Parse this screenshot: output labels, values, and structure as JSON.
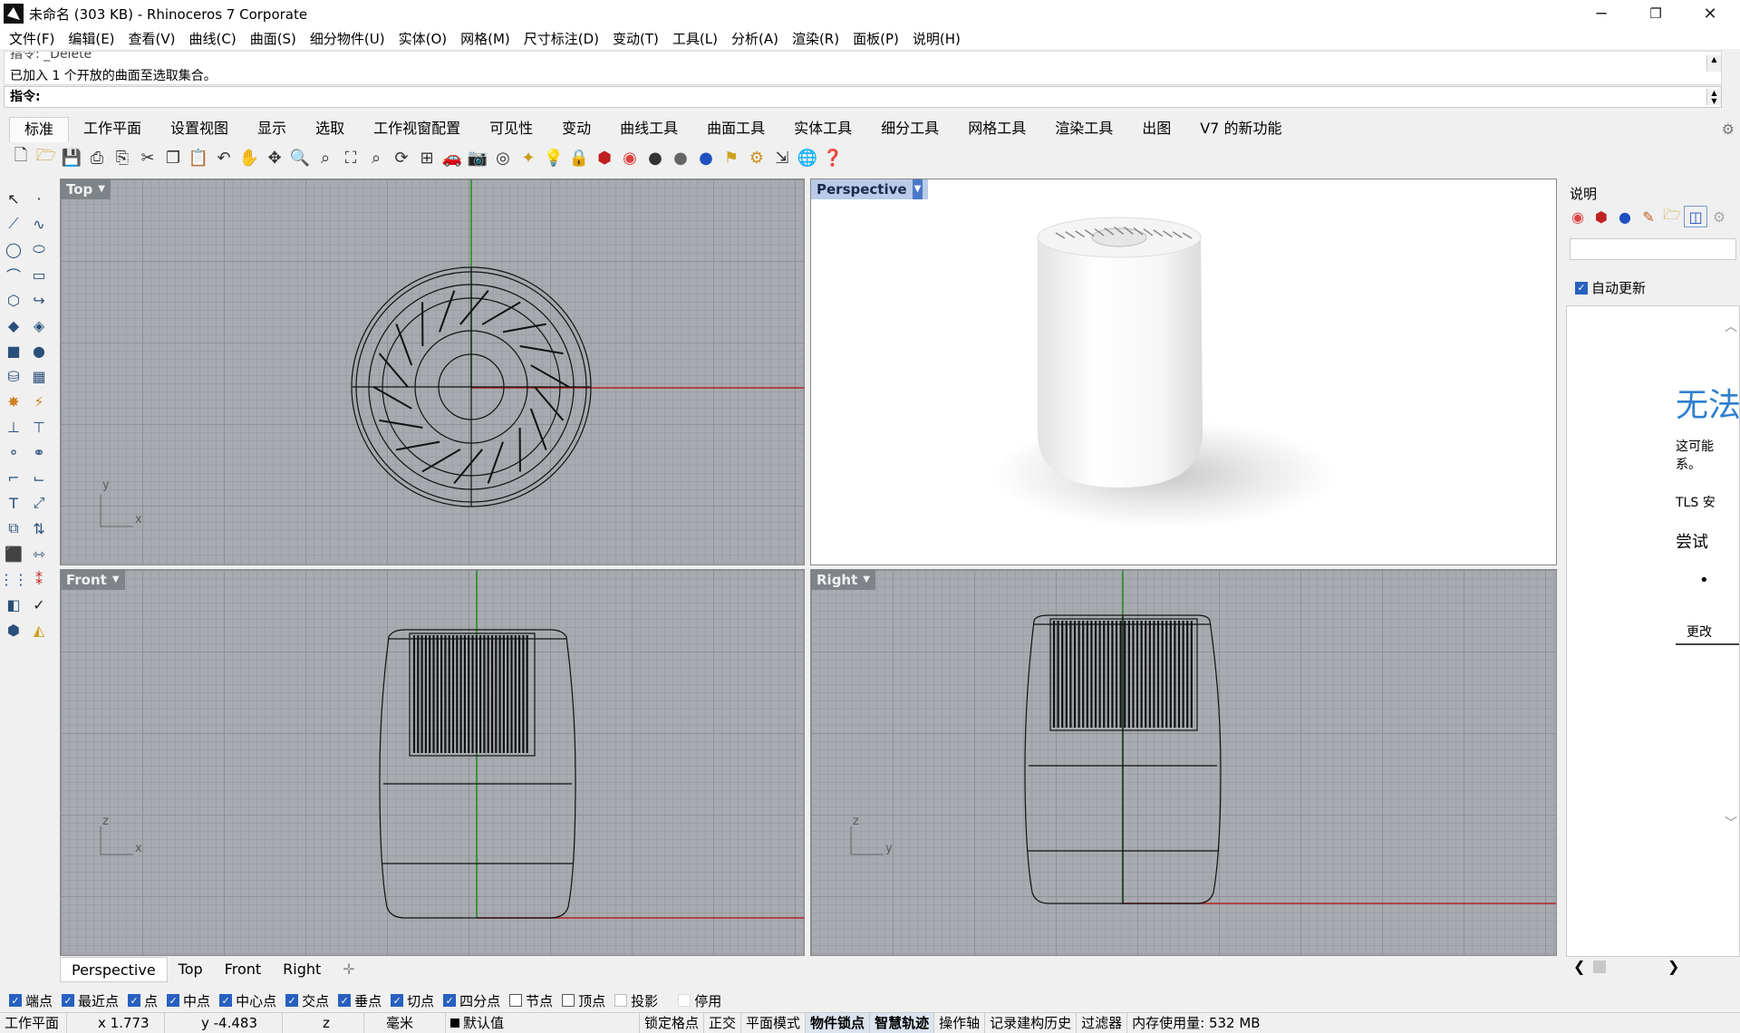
{
  "window": {
    "title": "未命名 (303 KB) - Rhinoceros 7 Corporate",
    "minimize": "─",
    "restore": "❐",
    "close": "✕"
  },
  "menu": [
    "文件(F)",
    "编辑(E)",
    "查看(V)",
    "曲线(C)",
    "曲面(S)",
    "细分物件(U)",
    "实体(O)",
    "网格(M)",
    "尺寸标注(D)",
    "变动(T)",
    "工具(L)",
    "分析(A)",
    "渲染(R)",
    "面板(P)",
    "说明(H)"
  ],
  "command": {
    "history_line1": "指令: _Delete",
    "history_line2": "已加入 1 个开放的曲面至选取集合。",
    "prompt": "指令:"
  },
  "tabs": [
    "标准",
    "工作平面",
    "设置视图",
    "显示",
    "选取",
    "工作视窗配置",
    "可见性",
    "变动",
    "曲线工具",
    "曲面工具",
    "实体工具",
    "细分工具",
    "网格工具",
    "渲染工具",
    "出图",
    "V7 的新功能"
  ],
  "active_tab": "标准",
  "toolbar_icons": [
    "new-file-icon",
    "open-file-icon",
    "save-icon",
    "print-icon",
    "import-icon",
    "cut-icon",
    "copy-icon",
    "paste-icon",
    "undo-icon",
    "pan-icon",
    "rotate-view-icon",
    "zoom-icon",
    "zoom-window-icon",
    "zoom-extents-icon",
    "zoom-selected-icon",
    "rotate-icon",
    "four-view-icon",
    "car-icon",
    "camera-icon",
    "target-icon",
    "set-point-icon",
    "light-bulb-icon",
    "lock-icon",
    "material-icon",
    "color-wheel-icon",
    "render-sphere-icon",
    "render-sphere-2-icon",
    "render-sphere-3-icon",
    "spotlight-icon",
    "gear-cog-icon",
    "transform-icon",
    "globe-icon",
    "help-icon"
  ],
  "viewports": {
    "top": {
      "label": "Top",
      "axis_x": "x",
      "axis_y": "y"
    },
    "perspective": {
      "label": "Perspective"
    },
    "front": {
      "label": "Front",
      "axis_x": "x",
      "axis_y": "z"
    },
    "right": {
      "label": "Right",
      "axis_x": "y",
      "axis_y": "z"
    }
  },
  "viewport_tabs": [
    "Perspective",
    "Top",
    "Front",
    "Right"
  ],
  "viewport_tab_add": "✛",
  "right_panel": {
    "title": "说明",
    "auto_update_label": "自动更新",
    "auto_update_checked": true,
    "browser": {
      "big_text": "无法",
      "line1": "这可能",
      "line2": "系。",
      "line3": "TLS 安",
      "line4": "尝试",
      "bullet": "•",
      "button": "更改"
    }
  },
  "osnaps": [
    {
      "label": "端点",
      "checked": true
    },
    {
      "label": "最近点",
      "checked": true
    },
    {
      "label": "点",
      "checked": true
    },
    {
      "label": "中点",
      "checked": true
    },
    {
      "label": "中心点",
      "checked": true
    },
    {
      "label": "交点",
      "checked": true
    },
    {
      "label": "垂点",
      "checked": true
    },
    {
      "label": "切点",
      "checked": true
    },
    {
      "label": "四分点",
      "checked": true
    },
    {
      "label": "节点",
      "checked": false
    },
    {
      "label": "顶点",
      "checked": false
    },
    {
      "label": "投影",
      "checked": false
    },
    {
      "label": "停用",
      "checked": false
    }
  ],
  "status": {
    "cplane": "工作平面",
    "x": "x 1.773",
    "y": "y -4.483",
    "z": "z",
    "units": "毫米",
    "layer": "默认值",
    "grid_snap": "锁定格点",
    "ortho": "正交",
    "planar": "平面模式",
    "osnap": "物件锁点",
    "smarttrack": "智慧轨迹",
    "gumball": "操作轴",
    "history": "记录建构历史",
    "filter": "过滤器",
    "memory": "内存使用量: 532 MB"
  },
  "colors": {
    "x_axis": "#b22222",
    "y_axis": "#1e8c1e",
    "active_viewport_title": "#b9cbe8",
    "grid_bg": "#a7abb0"
  }
}
